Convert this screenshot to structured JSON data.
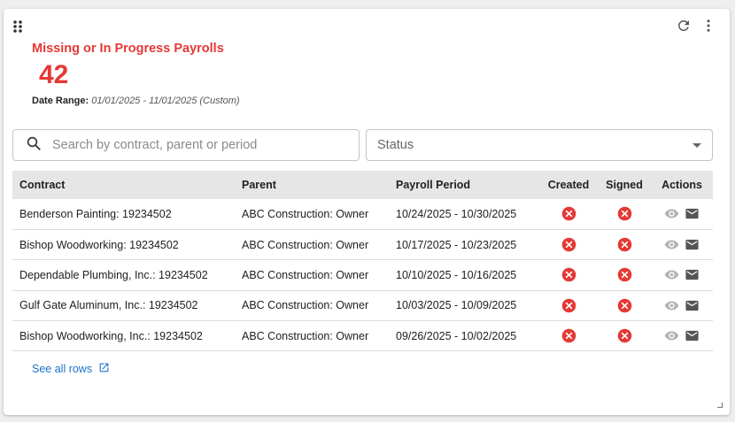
{
  "widget": {
    "title": "Missing or In Progress Payrolls",
    "count": "42",
    "date_range_label": "Date Range:",
    "date_range_value": "01/01/2025 - 11/01/2025 (Custom)",
    "accent_color": "#e53935"
  },
  "toolbar": {
    "icons": [
      "drag-handle-icon",
      "refresh-icon",
      "more-vert-icon"
    ]
  },
  "filters": {
    "search_placeholder": "Search by contract, parent or period",
    "search_value": "",
    "status_placeholder": "Status"
  },
  "table": {
    "columns": [
      "Contract",
      "Parent",
      "Payroll Period",
      "Created",
      "Signed",
      "Actions"
    ],
    "rows": [
      {
        "contract": "Benderson Painting: 19234502",
        "parent": "ABC Construction: Owner",
        "period": "10/24/2025 - 10/30/2025",
        "created": "x-circle-icon",
        "signed": "x-circle-icon"
      },
      {
        "contract": "Bishop Woodworking: 19234502",
        "parent": "ABC Construction: Owner",
        "period": "10/17/2025 - 10/23/2025",
        "created": "x-circle-icon",
        "signed": "x-circle-icon"
      },
      {
        "contract": "Dependable Plumbing, Inc.: 19234502",
        "parent": "ABC Construction: Owner",
        "period": "10/10/2025 - 10/16/2025",
        "created": "x-circle-icon",
        "signed": "x-circle-icon"
      },
      {
        "contract": "Gulf Gate Aluminum, Inc.: 19234502",
        "parent": "ABC Construction: Owner",
        "period": "10/03/2025 - 10/09/2025",
        "created": "x-circle-icon",
        "signed": "x-circle-icon"
      },
      {
        "contract": "Bishop Woodworking, Inc.: 19234502",
        "parent": "ABC Construction: Owner",
        "period": "09/26/2025 - 10/02/2025",
        "created": "x-circle-icon",
        "signed": "x-circle-icon"
      }
    ],
    "row_actions": [
      "eye-icon",
      "mail-icon"
    ]
  },
  "footer": {
    "see_all_label": "See all rows"
  }
}
